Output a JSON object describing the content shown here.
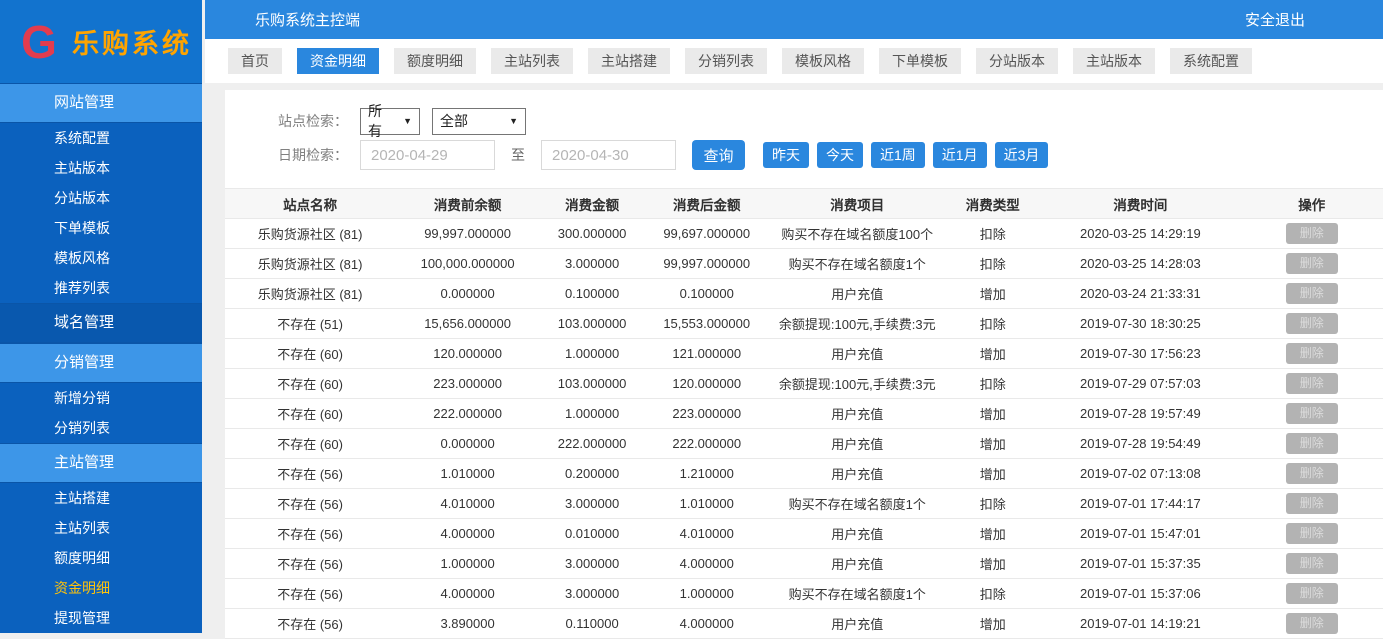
{
  "brand": {
    "logo_text": "乐购系统",
    "logo_icon_letter": "G"
  },
  "topbar": {
    "title": "乐购系统主控端",
    "logout_label": "安全退出"
  },
  "sidebar": {
    "items": [
      {
        "id": "website-management",
        "label": "网站管理",
        "type": "section",
        "active": false
      },
      {
        "id": "system-config",
        "label": "系统配置",
        "type": "item",
        "active": false
      },
      {
        "id": "mainsite-version",
        "label": "主站版本",
        "type": "item",
        "active": false
      },
      {
        "id": "subsite-version",
        "label": "分站版本",
        "type": "item",
        "active": false
      },
      {
        "id": "order-template",
        "label": "下单模板",
        "type": "item",
        "active": false
      },
      {
        "id": "template-style",
        "label": "模板风格",
        "type": "item",
        "active": false
      },
      {
        "id": "recommend-list",
        "label": "推荐列表",
        "type": "item",
        "active": false
      },
      {
        "id": "domain-management",
        "label": "域名管理",
        "type": "section-dark",
        "active": false
      },
      {
        "id": "distribution-management",
        "label": "分销管理",
        "type": "section",
        "active": false
      },
      {
        "id": "add-distribution",
        "label": "新增分销",
        "type": "item",
        "active": false
      },
      {
        "id": "distribution-list",
        "label": "分销列表",
        "type": "item",
        "active": false
      },
      {
        "id": "mainsite-management",
        "label": "主站管理",
        "type": "section",
        "active": false
      },
      {
        "id": "site-build",
        "label": "主站搭建",
        "type": "item",
        "active": false
      },
      {
        "id": "site-list",
        "label": "主站列表",
        "type": "item",
        "active": false
      },
      {
        "id": "quota-detail",
        "label": "额度明细",
        "type": "item",
        "active": false
      },
      {
        "id": "funds-detail",
        "label": "资金明细",
        "type": "item",
        "active": true
      },
      {
        "id": "withdraw-management",
        "label": "提现管理",
        "type": "item",
        "active": false
      }
    ]
  },
  "tabs": {
    "active_index": 1,
    "items": [
      {
        "id": "home",
        "label": "首页"
      },
      {
        "id": "funds-detail",
        "label": "资金明细"
      },
      {
        "id": "quota-detail",
        "label": "额度明细"
      },
      {
        "id": "site-list",
        "label": "主站列表"
      },
      {
        "id": "site-build",
        "label": "主站搭建"
      },
      {
        "id": "distribution-list",
        "label": "分销列表"
      },
      {
        "id": "template-style",
        "label": "模板风格"
      },
      {
        "id": "order-template",
        "label": "下单模板"
      },
      {
        "id": "subsite-version",
        "label": "分站版本"
      },
      {
        "id": "mainsite-version",
        "label": "主站版本"
      },
      {
        "id": "system-config",
        "label": "系统配置"
      }
    ]
  },
  "filters": {
    "site_label": "站点检索：",
    "site_select_1": "所有",
    "site_select_2": "全部",
    "date_label": "日期检索：",
    "date_from": "2020-04-29",
    "to_text": "至",
    "date_to": "2020-04-30",
    "query_button": "查询",
    "quick_buttons": [
      {
        "id": "yesterday",
        "label": "昨天"
      },
      {
        "id": "today",
        "label": "今天"
      },
      {
        "id": "last-1-week",
        "label": "近1周"
      },
      {
        "id": "last-1-month",
        "label": "近1月"
      },
      {
        "id": "last-3-months",
        "label": "近3月"
      }
    ]
  },
  "table": {
    "delete_label": "删除",
    "headers": [
      {
        "id": "site-name",
        "label": "站点名称"
      },
      {
        "id": "balance-before",
        "label": "消费前余额"
      },
      {
        "id": "amount",
        "label": "消费金额"
      },
      {
        "id": "balance-after",
        "label": "消费后金额"
      },
      {
        "id": "item",
        "label": "消费项目"
      },
      {
        "id": "type",
        "label": "消费类型"
      },
      {
        "id": "time",
        "label": "消费时间"
      },
      {
        "id": "action",
        "label": "操作"
      }
    ],
    "rows": [
      {
        "site": "乐购货源社区 (81)",
        "before": "99,997.000000",
        "amount": "300.000000",
        "after": "99,697.000000",
        "item": "购买不存在域名额度100个",
        "type": "扣除",
        "time": "2020-03-25 14:29:19"
      },
      {
        "site": "乐购货源社区 (81)",
        "before": "100,000.000000",
        "amount": "3.000000",
        "after": "99,997.000000",
        "item": "购买不存在域名额度1个",
        "type": "扣除",
        "time": "2020-03-25 14:28:03"
      },
      {
        "site": "乐购货源社区 (81)",
        "before": "0.000000",
        "amount": "0.100000",
        "after": "0.100000",
        "item": "用户充值",
        "type": "增加",
        "time": "2020-03-24 21:33:31"
      },
      {
        "site": "不存在 (51)",
        "before": "15,656.000000",
        "amount": "103.000000",
        "after": "15,553.000000",
        "item": "余额提现:100元,手续费:3元",
        "type": "扣除",
        "time": "2019-07-30 18:30:25"
      },
      {
        "site": "不存在 (60)",
        "before": "120.000000",
        "amount": "1.000000",
        "after": "121.000000",
        "item": "用户充值",
        "type": "增加",
        "time": "2019-07-30 17:56:23"
      },
      {
        "site": "不存在 (60)",
        "before": "223.000000",
        "amount": "103.000000",
        "after": "120.000000",
        "item": "余额提现:100元,手续费:3元",
        "type": "扣除",
        "time": "2019-07-29 07:57:03"
      },
      {
        "site": "不存在 (60)",
        "before": "222.000000",
        "amount": "1.000000",
        "after": "223.000000",
        "item": "用户充值",
        "type": "增加",
        "time": "2019-07-28 19:57:49"
      },
      {
        "site": "不存在 (60)",
        "before": "0.000000",
        "amount": "222.000000",
        "after": "222.000000",
        "item": "用户充值",
        "type": "增加",
        "time": "2019-07-28 19:54:49"
      },
      {
        "site": "不存在 (56)",
        "before": "1.010000",
        "amount": "0.200000",
        "after": "1.210000",
        "item": "用户充值",
        "type": "增加",
        "time": "2019-07-02 07:13:08"
      },
      {
        "site": "不存在 (56)",
        "before": "4.010000",
        "amount": "3.000000",
        "after": "1.010000",
        "item": "购买不存在域名额度1个",
        "type": "扣除",
        "time": "2019-07-01 17:44:17"
      },
      {
        "site": "不存在 (56)",
        "before": "4.000000",
        "amount": "0.010000",
        "after": "4.010000",
        "item": "用户充值",
        "type": "增加",
        "time": "2019-07-01 15:47:01"
      },
      {
        "site": "不存在 (56)",
        "before": "1.000000",
        "amount": "3.000000",
        "after": "4.000000",
        "item": "用户充值",
        "type": "增加",
        "time": "2019-07-01 15:37:35"
      },
      {
        "site": "不存在 (56)",
        "before": "4.000000",
        "amount": "3.000000",
        "after": "1.000000",
        "item": "购买不存在域名额度1个",
        "type": "扣除",
        "time": "2019-07-01 15:37:06"
      },
      {
        "site": "不存在 (56)",
        "before": "3.890000",
        "amount": "0.110000",
        "after": "4.000000",
        "item": "用户充值",
        "type": "增加",
        "time": "2019-07-01 14:19:21"
      }
    ]
  },
  "colors": {
    "accent_blue": "#2A87DE",
    "sidebar_blue": "#0B61BE",
    "sidebar_section_blue": "#3D96E8",
    "sidebar_section_dark_blue": "#0958AE",
    "logo_bg_blue": "#1273CE",
    "active_menu_yellow": "#FFC30B",
    "logo_text_orange": "#FFA400",
    "logo_icon_red": "#E23C4E",
    "page_bg_gray": "#EFEFEF",
    "delete_btn_gray": "#B3B3B3"
  }
}
